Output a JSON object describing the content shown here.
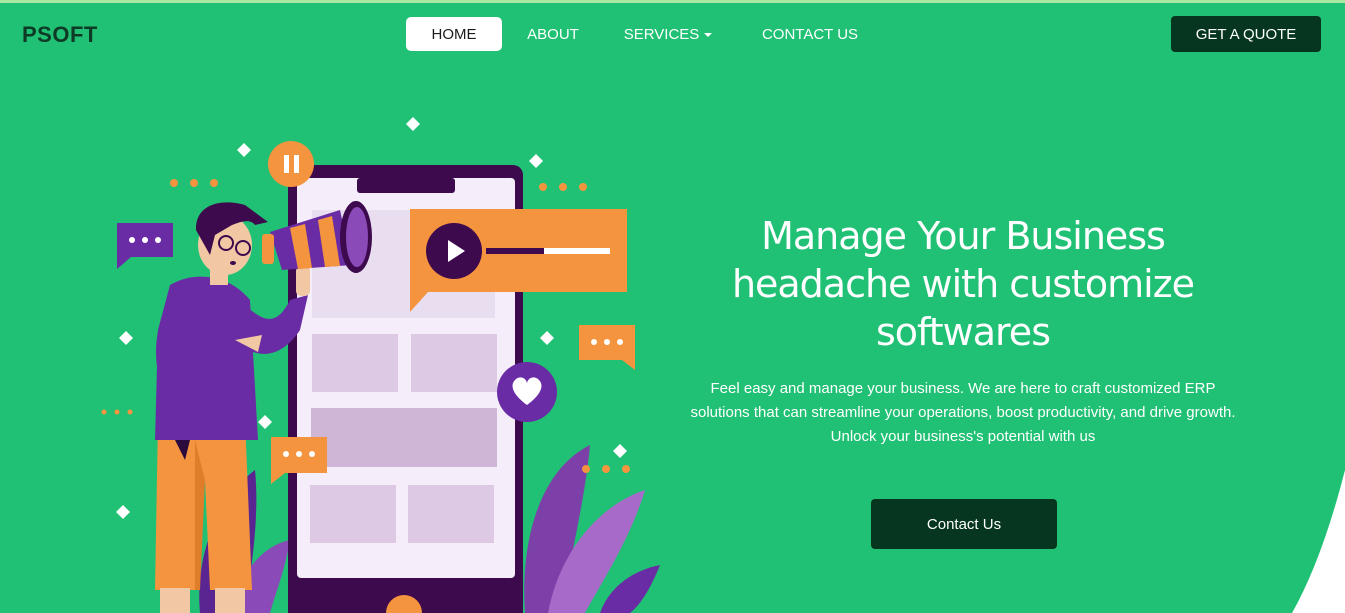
{
  "brand": {
    "name": "PSOFT"
  },
  "nav": {
    "items": [
      {
        "label": "HOME",
        "active": true
      },
      {
        "label": "ABOUT",
        "active": false
      },
      {
        "label": "SERVICES",
        "active": false,
        "has_dropdown": true
      },
      {
        "label": "CONTACT US",
        "active": false
      }
    ],
    "quote_label": "GET A QUOTE"
  },
  "hero": {
    "headline": "Manage Your Business headache with customize softwares",
    "description": "Feel easy and manage your business. We are here to craft customized ERP solutions that can streamline your operations, boost productivity, and drive growth. Unlock your business's potential with us",
    "cta_label": "Contact Us",
    "illustration_icon": "man-with-megaphone-and-phone-illustration"
  },
  "colors": {
    "brand_green": "#20c174",
    "dark_green": "#06361f",
    "purple": "#6a2ca5",
    "orange": "#f5943f",
    "white": "#ffffff"
  }
}
